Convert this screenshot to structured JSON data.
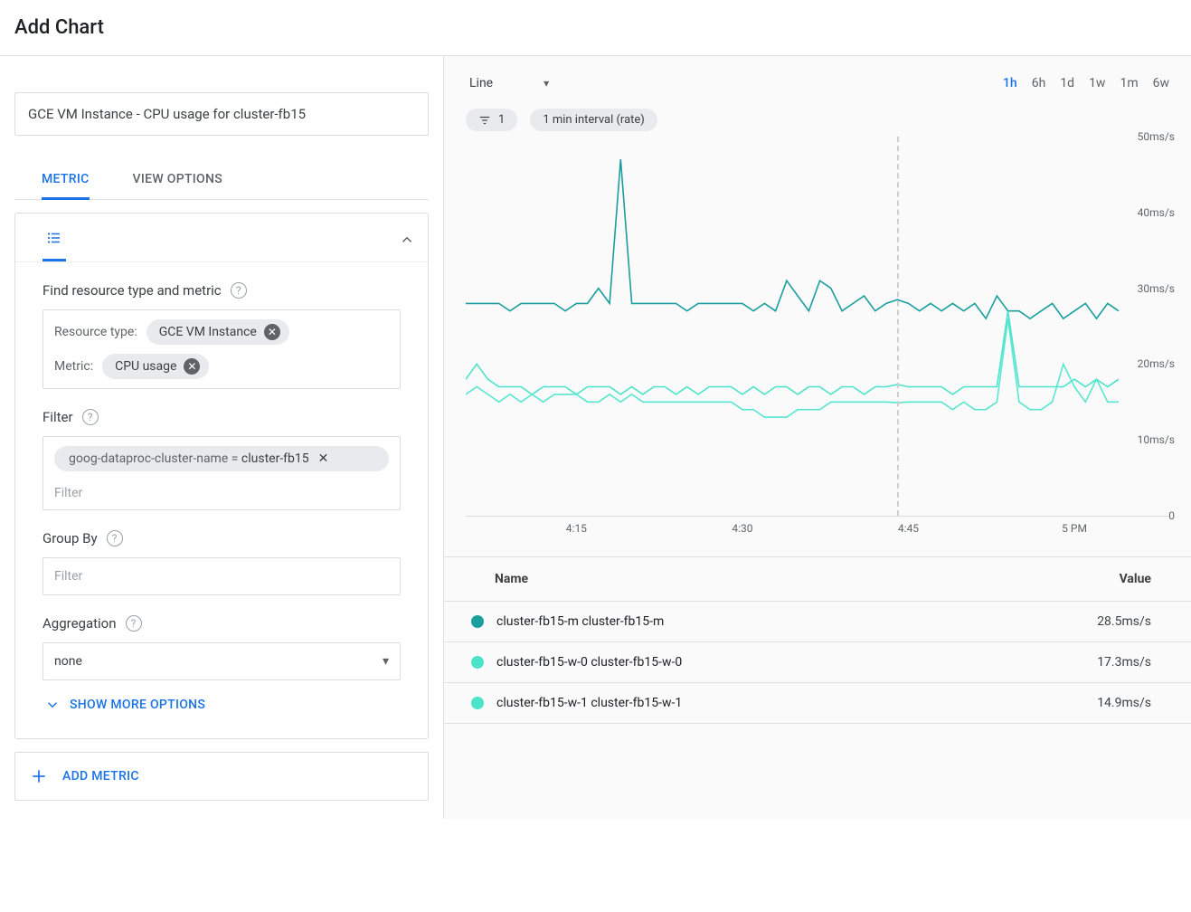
{
  "header": {
    "title": "Add Chart"
  },
  "left": {
    "chart_title_value": "GCE VM Instance - CPU usage for cluster-fb15",
    "tabs": {
      "metric": "METRIC",
      "view_options": "VIEW OPTIONS"
    },
    "metric_section": {
      "find_label": "Find resource type and metric",
      "resource_type_label": "Resource type:",
      "resource_type_chip": "GCE VM Instance",
      "metric_label": "Metric:",
      "metric_chip": "CPU usage"
    },
    "filter_section": {
      "label": "Filter",
      "chip_key": "goog-dataproc-cluster-name = ",
      "chip_value": "cluster-fb15",
      "placeholder": "Filter"
    },
    "groupby_section": {
      "label": "Group By",
      "placeholder": "Filter"
    },
    "aggregation_section": {
      "label": "Aggregation",
      "value": "none"
    },
    "show_more": "SHOW MORE OPTIONS",
    "add_metric": "ADD METRIC"
  },
  "right": {
    "chart_type": "Line",
    "timerange": [
      "1h",
      "6h",
      "1d",
      "1w",
      "1m",
      "6w"
    ],
    "timerange_active": "1h",
    "chips": {
      "filter_count": "1",
      "interval": "1 min interval (rate)"
    },
    "legend": {
      "name_header": "Name",
      "value_header": "Value",
      "rows": [
        {
          "color": "#1a9e9e",
          "name": "cluster-fb15-m cluster-fb15-m",
          "value": "28.5ms/s"
        },
        {
          "color": "#4be3c9",
          "name": "cluster-fb15-w-0 cluster-fb15-w-0",
          "value": "17.3ms/s"
        },
        {
          "color": "#4be3c9",
          "name": "cluster-fb15-w-1 cluster-fb15-w-1",
          "value": "14.9ms/s"
        }
      ]
    }
  },
  "chart_data": {
    "type": "line",
    "xlabel": "",
    "ylabel": "",
    "ylim": [
      0,
      50
    ],
    "y_unit": "ms/s",
    "x_ticks": [
      "4:15",
      "4:30",
      "4:45",
      "5 PM"
    ],
    "y_ticks": [
      0,
      10,
      20,
      30,
      40,
      50
    ],
    "cursor_x_index": 39,
    "n_points": 60,
    "series": [
      {
        "name": "cluster-fb15-m",
        "color": "#1a9e9e",
        "values": [
          28,
          28,
          28,
          28,
          27,
          28,
          28,
          28,
          28,
          27,
          28,
          28,
          30,
          28,
          47,
          28,
          28,
          28,
          28,
          28,
          27,
          28,
          28,
          28,
          28,
          28,
          27,
          28,
          27,
          31,
          29,
          27,
          31,
          30,
          27,
          28,
          29,
          27,
          28,
          28.5,
          28,
          27,
          28,
          27,
          28,
          27,
          28,
          26,
          29,
          27,
          27,
          26,
          27,
          28,
          26,
          27,
          28,
          26,
          28,
          27
        ]
      },
      {
        "name": "cluster-fb15-w-0",
        "color": "#4be3c9",
        "values": [
          18,
          20,
          18,
          17,
          17,
          17,
          16,
          17,
          17,
          17,
          16,
          17,
          17,
          17,
          16,
          17,
          16,
          17,
          17,
          16,
          17,
          16,
          17,
          17,
          17,
          16,
          17,
          16,
          17,
          17,
          16,
          17,
          17,
          16,
          17,
          17,
          16,
          17,
          17,
          17.3,
          17,
          17,
          17,
          17,
          16,
          17,
          17,
          17,
          17,
          27,
          17,
          17,
          17,
          17,
          17,
          18,
          17,
          18,
          17,
          18
        ]
      },
      {
        "name": "cluster-fb15-w-1",
        "color": "#57e6cf",
        "values": [
          16,
          17,
          16,
          15,
          16,
          15,
          16,
          15,
          16,
          16,
          16,
          15,
          15,
          16,
          15,
          16,
          15,
          15,
          15,
          15,
          15,
          15,
          15,
          15,
          15,
          14,
          14,
          13,
          13,
          13,
          14,
          14,
          14,
          15,
          15,
          15,
          15,
          15,
          15,
          14.9,
          15,
          15,
          15,
          15,
          14,
          15,
          14,
          14,
          15,
          26,
          15,
          14,
          14,
          15,
          20,
          17,
          15,
          18,
          15,
          15
        ]
      }
    ]
  }
}
